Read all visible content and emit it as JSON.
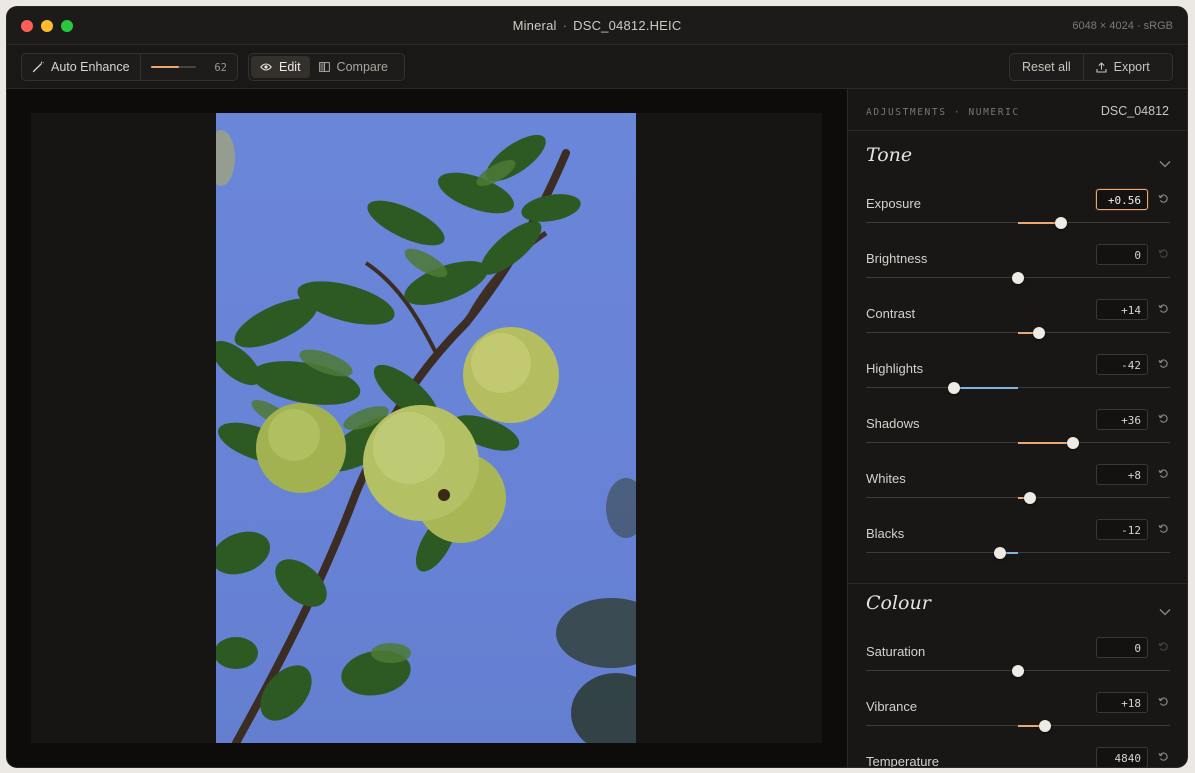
{
  "window": {
    "app_name": "Mineral",
    "separator": "·",
    "file_name": "DSC_04812.HEIC",
    "meta": "6048 × 4024 · sRGB"
  },
  "toolbar": {
    "auto_enhance_label": "Auto Enhance",
    "auto_enhance_value": "62",
    "auto_enhance_fraction": 0.62,
    "edit_label": "Edit",
    "compare_label": "Compare",
    "reset_all_label": "Reset all",
    "export_label": "Export"
  },
  "panel": {
    "kicker": "ADJUSTMENTS · NUMERIC",
    "file": "DSC_04812",
    "tone_title": "Tone",
    "colour_title": "Colour",
    "accent_positive": "#e9a873",
    "accent_negative": "#7fb6e0",
    "tone": [
      {
        "label": "Exposure",
        "value": "+0.56",
        "amount": 0.28,
        "focused": true,
        "reset_active": true
      },
      {
        "label": "Brightness",
        "value": "0",
        "amount": 0,
        "focused": false,
        "reset_active": false
      },
      {
        "label": "Contrast",
        "value": "+14",
        "amount": 0.14,
        "focused": false,
        "reset_active": true
      },
      {
        "label": "Highlights",
        "value": "-42",
        "amount": -0.42,
        "focused": false,
        "reset_active": true
      },
      {
        "label": "Shadows",
        "value": "+36",
        "amount": 0.36,
        "focused": false,
        "reset_active": true
      },
      {
        "label": "Whites",
        "value": "+8",
        "amount": 0.08,
        "focused": false,
        "reset_active": true
      },
      {
        "label": "Blacks",
        "value": "-12",
        "amount": -0.12,
        "focused": false,
        "reset_active": true
      }
    ],
    "colour": [
      {
        "label": "Saturation",
        "value": "0",
        "amount": 0,
        "focused": false,
        "reset_active": false
      },
      {
        "label": "Vibrance",
        "value": "+18",
        "amount": 0.18,
        "focused": false,
        "reset_active": true
      },
      {
        "label": "Temperature",
        "value": "4840",
        "amount": 0,
        "focused": false,
        "reset_active": true
      }
    ]
  }
}
